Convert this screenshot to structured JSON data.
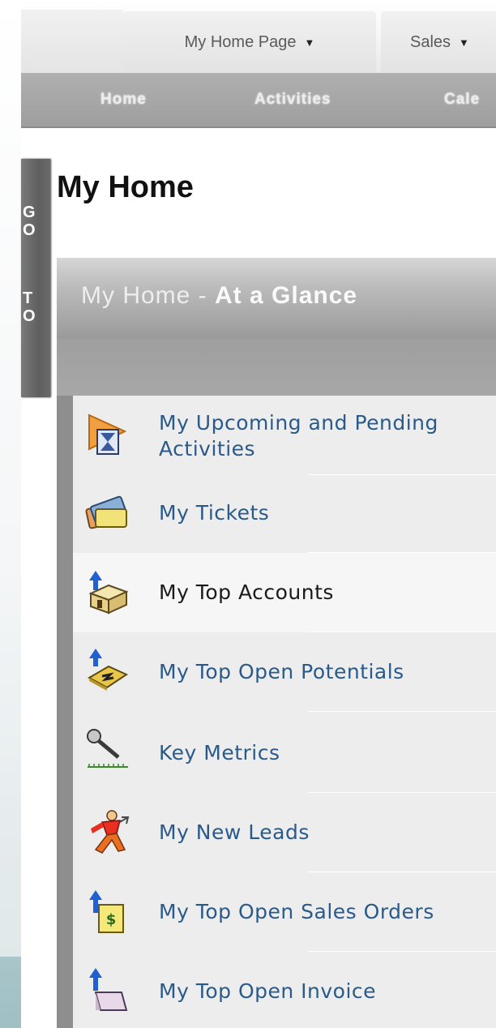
{
  "top_tabs": [
    {
      "label": "My Home Page",
      "has_dropdown": true
    },
    {
      "label": "Sales",
      "has_dropdown": true
    }
  ],
  "sub_nav": [
    "Home",
    "Activities",
    "Cale"
  ],
  "goto_label": [
    "G",
    "O",
    "T",
    "O"
  ],
  "page_title": "My Home",
  "panel": {
    "title_prefix": "My Home - ",
    "title_emphasis": "At a Glance"
  },
  "items": [
    {
      "label": "My Upcoming and Pending Activities",
      "icon": "hourglass-activity-icon"
    },
    {
      "label": "My Tickets",
      "icon": "tickets-icon"
    },
    {
      "label": "My Top Accounts",
      "icon": "accounts-icon",
      "active": true
    },
    {
      "label": "My Top Open Potentials",
      "icon": "potentials-icon"
    },
    {
      "label": "Key Metrics",
      "icon": "key-metrics-icon"
    },
    {
      "label": "My New Leads",
      "icon": "new-leads-icon"
    },
    {
      "label": "My Top Open Sales Orders",
      "icon": "sales-orders-icon"
    },
    {
      "label": "My Top Open Invoice",
      "icon": "invoice-icon"
    }
  ],
  "colors": {
    "link": "#2a5a8a",
    "subnav_bg": "#a3a3a3",
    "goto_bg": "#666666"
  }
}
